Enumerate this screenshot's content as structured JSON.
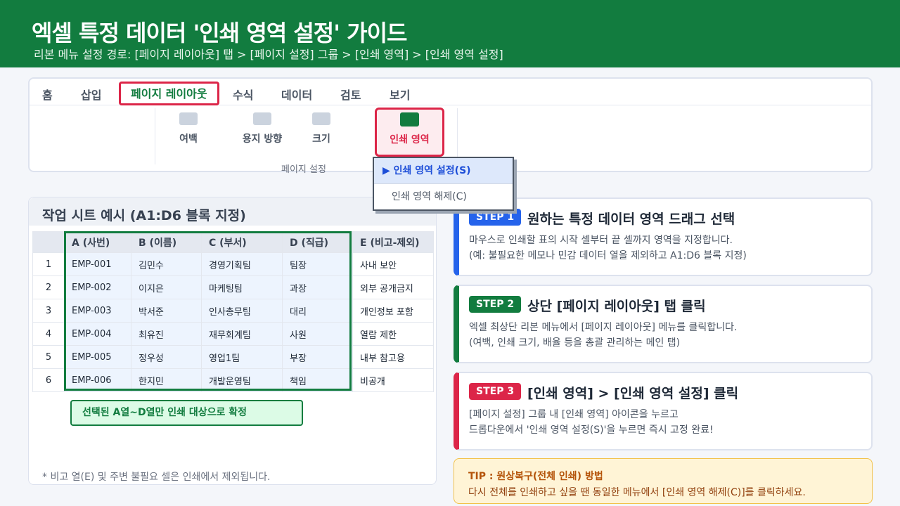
{
  "header": {
    "title": "엑셀 특정 데이터 '인쇄 영역 설정' 가이드",
    "path": "리본 메뉴 설정 경로: [페이지 레이아웃] 탭 > [페이지 설정] 그룹 > [인쇄 영역] > [인쇄 영역 설정]",
    "background_color": "#127c3f"
  },
  "ribbon": {
    "tabs": [
      "홈",
      "삽입",
      "페이지 레이아웃",
      "수식",
      "데이터",
      "검토",
      "보기"
    ],
    "active_tab": "페이지 레이아웃",
    "buttons": [
      "여백",
      "용지 방향",
      "크기",
      "인쇄 영역"
    ],
    "highlighted_button": "인쇄 영역",
    "group_label": "페이지 설정",
    "highlight_color": "#dc2548"
  },
  "dropdown": {
    "selected": "▶ 인쇄 영역 설정(S)",
    "other": "인쇄 영역 해제(C)"
  },
  "sheet": {
    "title": "작업 시트 예시 (A1:D6 블록 지정)",
    "columns": [
      "A (사번)",
      "B (이름)",
      "C (부서)",
      "D (직급)",
      "E (비고-제외)"
    ],
    "rows": [
      {
        "num": "1",
        "cells": [
          "EMP-001",
          "김민수",
          "경영기획팀",
          "팀장",
          "사내 보안"
        ]
      },
      {
        "num": "2",
        "cells": [
          "EMP-002",
          "이지은",
          "마케팅팀",
          "과장",
          "외부 공개금지"
        ]
      },
      {
        "num": "3",
        "cells": [
          "EMP-003",
          "박서준",
          "인사총무팀",
          "대리",
          "개인정보 포함"
        ]
      },
      {
        "num": "4",
        "cells": [
          "EMP-004",
          "최유진",
          "재무회계팀",
          "사원",
          "열람 제한"
        ]
      },
      {
        "num": "5",
        "cells": [
          "EMP-005",
          "정우성",
          "영업1팀",
          "부장",
          "내부 참고용"
        ]
      },
      {
        "num": "6",
        "cells": [
          "EMP-006",
          "한지민",
          "개발운영팀",
          "책임",
          "비공개"
        ]
      }
    ],
    "selection_label": "선택된 A열~D열만 인쇄 대상으로 확정",
    "note": "* 비고 열(E) 및 주변 불필요 셀은 인쇄에서 제외됩니다.",
    "selection_color": "#127c3f"
  },
  "steps": [
    {
      "badge": "STEP 1",
      "title": "원하는 특정 데이터 영역 드래그 선택",
      "line1": "마우스로 인쇄할 표의 시작 셀부터 끝 셀까지 영역을 지정합니다.",
      "line2": "(예: 불필요한 메모나 민감 데이터 열을 제외하고 A1:D6 블록 지정)",
      "color": "#2563eb"
    },
    {
      "badge": "STEP 2",
      "title": "상단 [페이지 레이아웃] 탭 클릭",
      "line1": "엑셀 최상단 리본 메뉴에서 [페이지 레이아웃] 메뉴를 클릭합니다.",
      "line2": "(여백, 인쇄 크기, 배율 등을 총괄 관리하는 메인 탭)",
      "color": "#127c3f"
    },
    {
      "badge": "STEP 3",
      "title": "[인쇄 영역] > [인쇄 영역 설정] 클릭",
      "line1": "[페이지 설정] 그룹 내 [인쇄 영역] 아이콘을 누르고",
      "line2": "드롭다운에서 '인쇄 영역 설정(S)'을 누르면 즉시 고정 완료!",
      "color": "#dc2548"
    }
  ],
  "tip": {
    "title": "TIP : 원상복구(전체 인쇄) 방법",
    "text": "다시 전체를 인쇄하고 싶을 땐 동일한 메뉴에서 [인쇄 영역 해제(C)]를 클릭하세요.",
    "color": "#b45309"
  }
}
